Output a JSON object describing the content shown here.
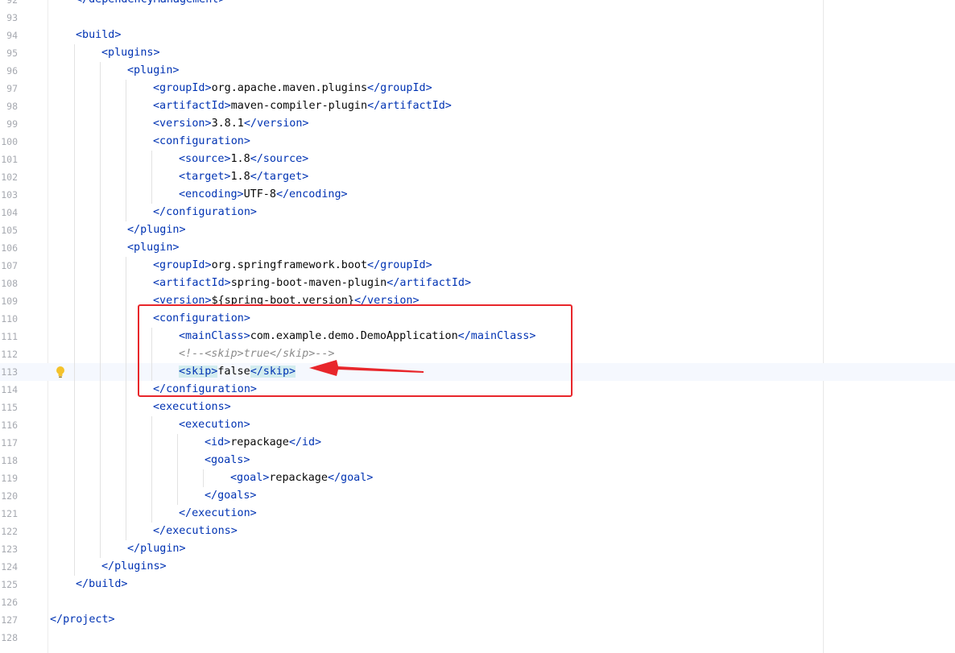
{
  "editor": {
    "current_line": "113",
    "lines": [
      {
        "n": "92",
        "indent": 1,
        "parts": [
          [
            "tag",
            "</dependencyManagement>"
          ]
        ]
      },
      {
        "n": "93",
        "indent": 0,
        "parts": []
      },
      {
        "n": "94",
        "indent": 1,
        "parts": [
          [
            "tag",
            "<build>"
          ]
        ]
      },
      {
        "n": "95",
        "indent": 2,
        "parts": [
          [
            "tag",
            "<plugins>"
          ]
        ]
      },
      {
        "n": "96",
        "indent": 3,
        "parts": [
          [
            "tag",
            "<plugin>"
          ]
        ]
      },
      {
        "n": "97",
        "indent": 4,
        "parts": [
          [
            "tag",
            "<groupId>"
          ],
          [
            "val",
            "org.apache.maven.plugins"
          ],
          [
            "tag",
            "</groupId>"
          ]
        ]
      },
      {
        "n": "98",
        "indent": 4,
        "parts": [
          [
            "tag",
            "<artifactId>"
          ],
          [
            "val",
            "maven-compiler-plugin"
          ],
          [
            "tag",
            "</artifactId>"
          ]
        ]
      },
      {
        "n": "99",
        "indent": 4,
        "parts": [
          [
            "tag",
            "<version>"
          ],
          [
            "val",
            "3.8.1"
          ],
          [
            "tag",
            "</version>"
          ]
        ]
      },
      {
        "n": "100",
        "indent": 4,
        "parts": [
          [
            "tag",
            "<configuration>"
          ]
        ]
      },
      {
        "n": "101",
        "indent": 5,
        "parts": [
          [
            "tag",
            "<source>"
          ],
          [
            "val",
            "1.8"
          ],
          [
            "tag",
            "</source>"
          ]
        ]
      },
      {
        "n": "102",
        "indent": 5,
        "parts": [
          [
            "tag",
            "<target>"
          ],
          [
            "val",
            "1.8"
          ],
          [
            "tag",
            "</target>"
          ]
        ]
      },
      {
        "n": "103",
        "indent": 5,
        "parts": [
          [
            "tag",
            "<encoding>"
          ],
          [
            "val",
            "UTF-8"
          ],
          [
            "tag",
            "</encoding>"
          ]
        ]
      },
      {
        "n": "104",
        "indent": 4,
        "parts": [
          [
            "tag",
            "</configuration>"
          ]
        ]
      },
      {
        "n": "105",
        "indent": 3,
        "parts": [
          [
            "tag",
            "</plugin>"
          ]
        ]
      },
      {
        "n": "106",
        "indent": 3,
        "parts": [
          [
            "tag",
            "<plugin>"
          ]
        ]
      },
      {
        "n": "107",
        "indent": 4,
        "parts": [
          [
            "tag",
            "<groupId>"
          ],
          [
            "val",
            "org.springframework.boot"
          ],
          [
            "tag",
            "</groupId>"
          ]
        ]
      },
      {
        "n": "108",
        "indent": 4,
        "parts": [
          [
            "tag",
            "<artifactId>"
          ],
          [
            "val",
            "spring-boot-maven-plugin"
          ],
          [
            "tag",
            "</artifactId>"
          ]
        ]
      },
      {
        "n": "109",
        "indent": 4,
        "parts": [
          [
            "tag",
            "<version>"
          ],
          [
            "val",
            "${spring-boot.version}"
          ],
          [
            "tag",
            "</version>"
          ]
        ]
      },
      {
        "n": "110",
        "indent": 4,
        "parts": [
          [
            "tag",
            "<configuration>"
          ]
        ]
      },
      {
        "n": "111",
        "indent": 5,
        "parts": [
          [
            "tag",
            "<mainClass>"
          ],
          [
            "val",
            "com.example.demo.DemoApplication"
          ],
          [
            "tag",
            "</mainClass>"
          ]
        ]
      },
      {
        "n": "112",
        "indent": 5,
        "parts": [
          [
            "cmt",
            "<!--<skip>true</skip>-->"
          ]
        ]
      },
      {
        "n": "113",
        "indent": 5,
        "parts": [
          [
            "tag hl",
            "<skip>"
          ],
          [
            "val",
            "false"
          ],
          [
            "tag hl",
            "</skip>"
          ]
        ]
      },
      {
        "n": "114",
        "indent": 4,
        "parts": [
          [
            "tag",
            "</configuration>"
          ]
        ]
      },
      {
        "n": "115",
        "indent": 4,
        "parts": [
          [
            "tag",
            "<executions>"
          ]
        ]
      },
      {
        "n": "116",
        "indent": 5,
        "parts": [
          [
            "tag",
            "<execution>"
          ]
        ]
      },
      {
        "n": "117",
        "indent": 6,
        "parts": [
          [
            "tag",
            "<id>"
          ],
          [
            "val",
            "repackage"
          ],
          [
            "tag",
            "</id>"
          ]
        ]
      },
      {
        "n": "118",
        "indent": 6,
        "parts": [
          [
            "tag",
            "<goals>"
          ]
        ]
      },
      {
        "n": "119",
        "indent": 7,
        "parts": [
          [
            "tag",
            "<goal>"
          ],
          [
            "val",
            "repackage"
          ],
          [
            "tag",
            "</goal>"
          ]
        ]
      },
      {
        "n": "120",
        "indent": 6,
        "parts": [
          [
            "tag",
            "</goals>"
          ]
        ]
      },
      {
        "n": "121",
        "indent": 5,
        "parts": [
          [
            "tag",
            "</execution>"
          ]
        ]
      },
      {
        "n": "122",
        "indent": 4,
        "parts": [
          [
            "tag",
            "</executions>"
          ]
        ]
      },
      {
        "n": "123",
        "indent": 3,
        "parts": [
          [
            "tag",
            "</plugin>"
          ]
        ]
      },
      {
        "n": "124",
        "indent": 2,
        "parts": [
          [
            "tag",
            "</plugins>"
          ]
        ]
      },
      {
        "n": "125",
        "indent": 1,
        "parts": [
          [
            "tag",
            "</build>"
          ]
        ]
      },
      {
        "n": "126",
        "indent": 0,
        "parts": []
      },
      {
        "n": "127",
        "indent": 0,
        "parts": [
          [
            "tag",
            "</project>"
          ]
        ]
      },
      {
        "n": "128",
        "indent": 0,
        "parts": []
      }
    ]
  },
  "gutter_icons": {
    "line_113": "lightbulb-icon"
  },
  "annotation": {
    "box_color": "#e8262b",
    "arrow_color": "#e8262b",
    "arrow_target_line": "113"
  }
}
